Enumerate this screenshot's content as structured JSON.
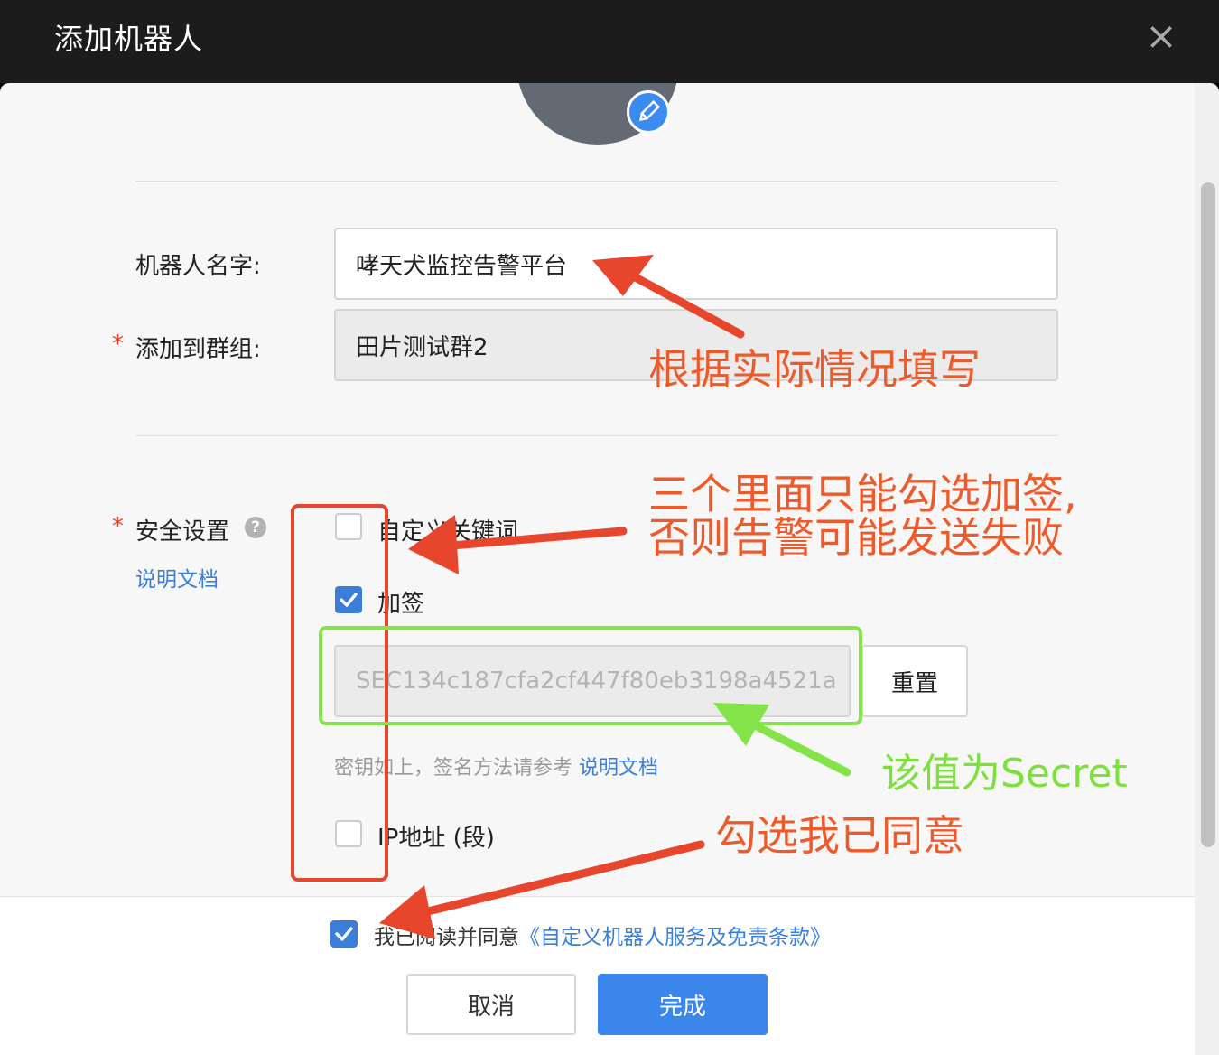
{
  "window": {
    "title": "添加机器人"
  },
  "form": {
    "name_label": "机器人名字:",
    "name_value": "哮天犬监控告警平台",
    "group_required_mark": "*",
    "group_label": "添加到群组:",
    "group_value": "田片测试群2",
    "security_required_mark": "*",
    "security_label": "安全设置",
    "help_glyph": "?",
    "docs_link": "说明文档",
    "options": [
      {
        "label": "自定义关键词",
        "checked": false
      },
      {
        "label": "加签",
        "checked": true
      },
      {
        "label": "IP地址 (段)",
        "checked": false
      }
    ],
    "secret_value": "SEC134c187cfa2cf447f80eb3198a4521a",
    "reset_label": "重置",
    "hint_text": "密钥如上，签名方法请参考",
    "hint_link": "说明文档"
  },
  "footer": {
    "agree_checked": true,
    "agree_text": "我已阅读并同意",
    "agree_link": "《自定义机器人服务及免责条款》",
    "cancel_label": "取消",
    "ok_label": "完成"
  },
  "annotations": {
    "fill_note": "根据实际情况填写",
    "select_note_line1": "三个里面只能勾选加签,",
    "select_note_line2": "否则告警可能发送失败",
    "secret_note": "该值为Secret",
    "agree_note": "勾选我已同意"
  },
  "colors": {
    "annotation_red": "#ee5a2a",
    "annotation_green": "#7ee03a",
    "accent": "#3a86ea",
    "titlebar": "#1c1c1c"
  }
}
